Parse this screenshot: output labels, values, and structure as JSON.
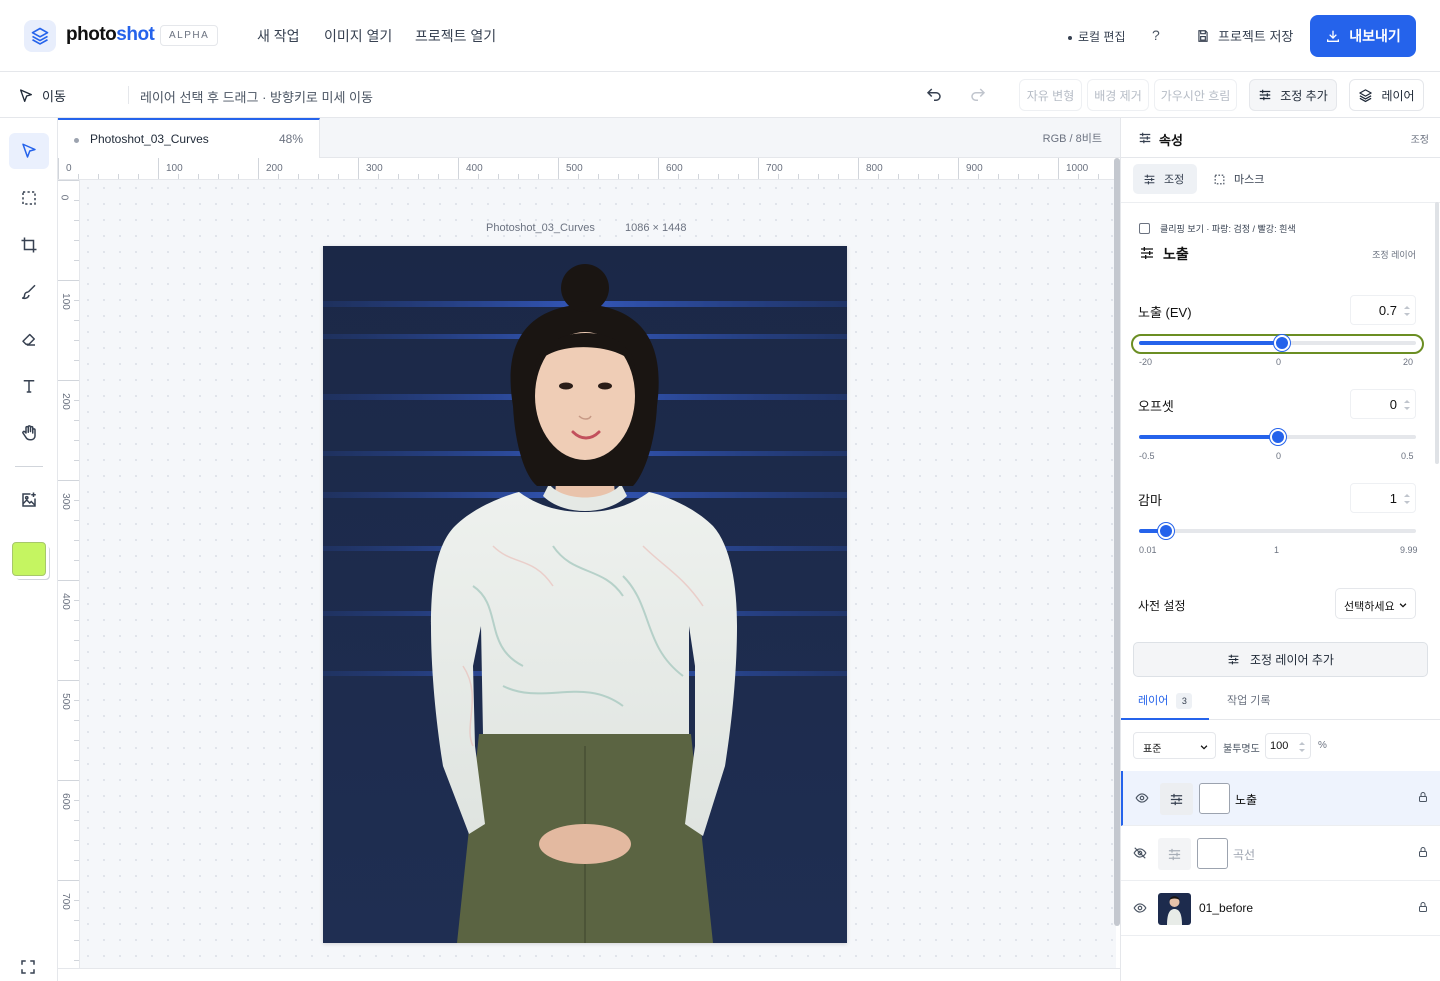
{
  "header": {
    "brand_prefix": "photo",
    "brand_suffix": "shot",
    "badge": "ALPHA",
    "nav": [
      "새 작업",
      "이미지 열기",
      "프로젝트 열기"
    ],
    "local_edit": "로컬 편집",
    "help": "?",
    "save_project": "프로젝트 저장",
    "export": "내보내기"
  },
  "toolbar": {
    "move_label": "이동",
    "hint": "레이어 선택 후 드래그 · 방향키로 미세 이동",
    "free_transform": "자유 변형",
    "remove_bg": "배경 제거",
    "gaussian_blur": "가우시안 흐림",
    "add_adjustment": "조정 추가",
    "layers": "레이어"
  },
  "document": {
    "tab_name": "Photoshot_03_Curves",
    "zoom": "48%",
    "color_mode": "RGB / 8비트",
    "image_label": "Photoshot_03_Curves",
    "image_size": "1086 × 1448"
  },
  "rulers": {
    "horizontal": [
      "0",
      "100",
      "200",
      "300",
      "400",
      "500",
      "600",
      "700",
      "800",
      "900",
      "1000"
    ],
    "vertical": [
      "0",
      "100",
      "200",
      "300",
      "400",
      "500",
      "600",
      "700"
    ]
  },
  "tools": {
    "foreground_color": "#c5f561",
    "accent": "#2563eb"
  },
  "properties": {
    "title": "속성",
    "subtitle": "조정",
    "tab_adjust": "조정",
    "tab_mask": "마스크",
    "clip_hint": "클리핑 보기 · 파랑: 검정 / 빨강: 흰색",
    "section_title": "노출",
    "section_sub": "조정 레이어",
    "params": [
      {
        "label": "노출 (EV)",
        "value": "0.7",
        "min": -20,
        "max": 20,
        "current": 0.7,
        "ticks": [
          "-20",
          "0",
          "20"
        ]
      },
      {
        "label": "오프셋",
        "value": "0",
        "min": -0.5,
        "max": 0.5,
        "current": 0,
        "ticks": [
          "-0.5",
          "0",
          "0.5"
        ]
      },
      {
        "label": "감마",
        "value": "1",
        "min": 0.01,
        "max": 9.99,
        "current": 1,
        "ticks": [
          "0.01",
          "1",
          "9.99"
        ]
      }
    ],
    "preset_label": "사전 설정",
    "preset_value": "선택하세요",
    "add_adjustment_layer": "조정 레이어 추가"
  },
  "layers_panel": {
    "tab_layers": "레이어",
    "layer_count": "3",
    "tab_history": "작업 기록",
    "blend_mode": "표준",
    "opacity_label": "불투명도",
    "opacity_value": "100",
    "opacity_unit": "%",
    "layers": [
      {
        "name": "노출",
        "visible": true,
        "selected": true
      },
      {
        "name": "곡선",
        "visible": false,
        "selected": false
      },
      {
        "name": "01_before",
        "visible": true,
        "selected": false
      }
    ]
  }
}
